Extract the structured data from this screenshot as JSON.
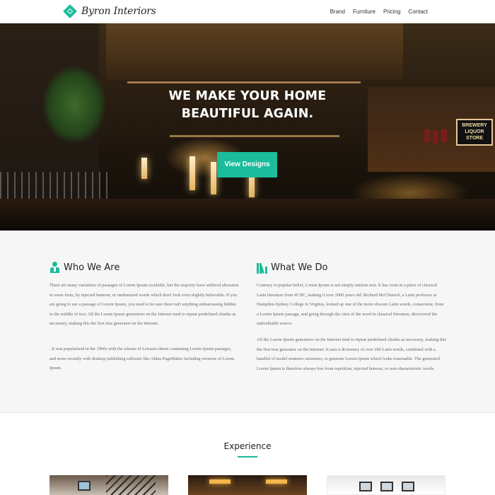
{
  "nav": {
    "brand": "Byron Interiors",
    "logo_icon": "diamond-logo-icon",
    "links": [
      "Brand",
      "Furniture",
      "Pricing",
      "Contact"
    ]
  },
  "hero": {
    "title_line1": "WE MAKE YOUR HOME",
    "title_line2": "BEAUTIFUL AGAIN.",
    "cta": "View Designs",
    "sign_text": "BREWERY LIQUOR STORE"
  },
  "about": {
    "who": {
      "icon": "person-icon",
      "title": "Who We Are",
      "p1": "There are many variations of passages of Lorem Ipsum available, but the majority have suffered alteration in some form, by injected humour, or randomised words which don't look even slightly believable. If you are going to use a passage of Lorem Ipsum, you need to be sure there isn't anything embarrassing hidden in the middle of text. All the Lorem Ipsum generators on the Internet tend to repeat predefined chunks as necessary, making this the first true generator on the Internet.",
      "p2": ". It was popularised in the 1960s with the release of Letraset sheets containing Lorem Ipsum passages, and more recently with desktop publishing software like Aldus PageMaker including versions of Lorem Ipsum."
    },
    "what": {
      "icon": "books-icon",
      "title": "What We Do",
      "p1": "Contrary to popular belief, Lorem Ipsum is not simply random text. It has roots in a piece of classical Latin literature from 45 BC, making it over 2000 years old. Richard McClintock, a Latin professor at Hampden-Sydney College in Virginia, looked up one of the more obscure Latin words, consectetur, from a Lorem Ipsum passage, and going through the cites of the word in classical literature, discovered the undoubtable source.",
      "p2": "All the Lorem Ipsum generators on the Internet tend to repeat predefined chunks as necessary, making this the first true generator on the Internet. It uses a dictionary of over 200 Latin words, combined with a handful of model sentence structures, to generate Lorem Ipsum which looks reasonable. The generated Lorem Ipsum is therefore always free from repetition, injected humour, or non-characteristic words."
    }
  },
  "experience": {
    "title": "Experience"
  },
  "colors": {
    "accent": "#1abc9c",
    "section_bg": "#f6f6f6"
  }
}
